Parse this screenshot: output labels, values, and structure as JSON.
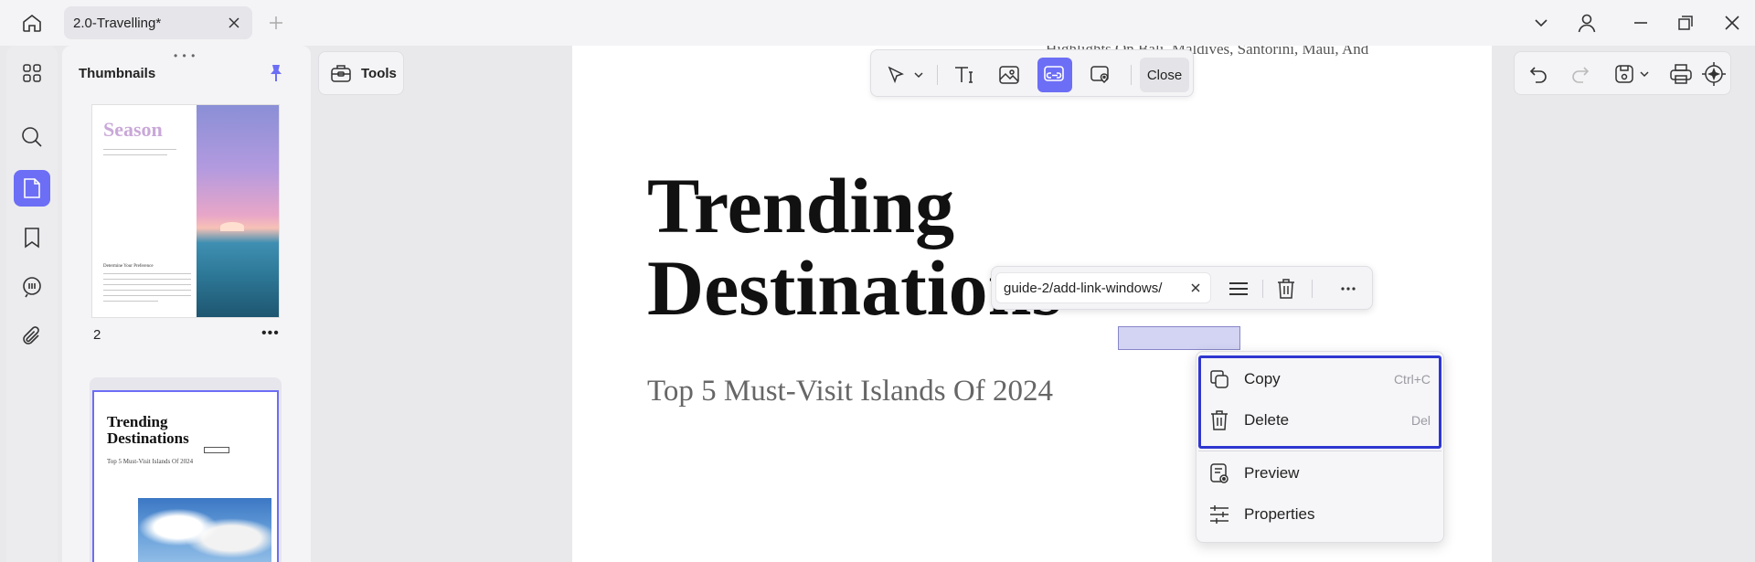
{
  "tabs": [
    {
      "label": "2.0-Travelling*"
    }
  ],
  "sidebar": {
    "items": [
      {
        "icon": "grid-icon"
      },
      {
        "icon": "search-icon"
      },
      {
        "icon": "page-icon",
        "active": true
      },
      {
        "icon": "bookmark-icon"
      },
      {
        "icon": "comment-icon"
      },
      {
        "icon": "attachment-icon"
      }
    ]
  },
  "thumbnails": {
    "title": "Thumbnails",
    "pages": [
      {
        "number": "2",
        "cover_text": "Season",
        "heading": "Determine Your Preference"
      },
      {
        "number": "",
        "title_line1": "Trending",
        "title_line2": "Destinations",
        "subtitle": "Top 5 Must-Visit Islands Of 2024"
      }
    ]
  },
  "tools": {
    "label": "Tools"
  },
  "edit_toolbar": {
    "close_label": "Close"
  },
  "document": {
    "prev_text": "Highlights On Bali, Maldives, Santorini, Maui, And",
    "title_line1": "Trending",
    "title_line2": "Destinations",
    "subtitle": "Top 5 Must-Visit Islands Of 2024"
  },
  "link_popup": {
    "url": "guide-2/add-link-windows/"
  },
  "context_menu": {
    "items": [
      {
        "label": "Copy",
        "shortcut": "Ctrl+C",
        "icon": "copy-icon"
      },
      {
        "label": "Delete",
        "shortcut": "Del",
        "icon": "trash-icon"
      },
      {
        "label": "Preview",
        "icon": "preview-icon"
      },
      {
        "label": "Properties",
        "icon": "sliders-icon"
      }
    ]
  },
  "colors": {
    "accent": "#6c6ef5",
    "highlight_border": "#2f36d0"
  }
}
